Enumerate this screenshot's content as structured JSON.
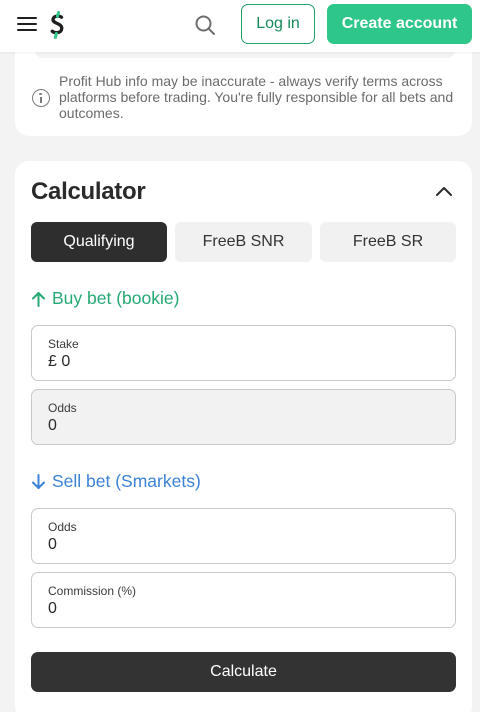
{
  "colors": {
    "brand_green": "#2fc68a",
    "buy_green": "#25a873",
    "sell_blue": "#3c82d6",
    "dark": "#2e2e2e"
  },
  "header": {
    "menu_icon": "hamburger-icon",
    "logo": "profit-hub-logo",
    "search_icon": "search-icon",
    "login_label": "Log in",
    "create_label": "Create account"
  },
  "info": {
    "icon": "info-icon",
    "text": "Profit Hub info may be inaccurate - always verify terms across platforms before trading. You're fully responsible for all bets and outcomes."
  },
  "calculator": {
    "title": "Calculator",
    "collapse_icon": "chevron-up-icon",
    "tabs": [
      {
        "label": "Qualifying",
        "active": true
      },
      {
        "label": "FreeB SNR",
        "active": false
      },
      {
        "label": "FreeB SR",
        "active": false
      }
    ],
    "buy": {
      "heading": "Buy bet (bookie)",
      "icon": "arrow-up-icon",
      "stake_label": "Stake",
      "stake_value": "£ 0",
      "odds_label": "Odds",
      "odds_value": "0"
    },
    "sell": {
      "heading": "Sell bet (Smarkets)",
      "icon": "arrow-down-icon",
      "odds_label": "Odds",
      "odds_value": "0",
      "commission_label": "Commission (%)",
      "commission_value": "0"
    },
    "calculate_label": "Calculate"
  }
}
